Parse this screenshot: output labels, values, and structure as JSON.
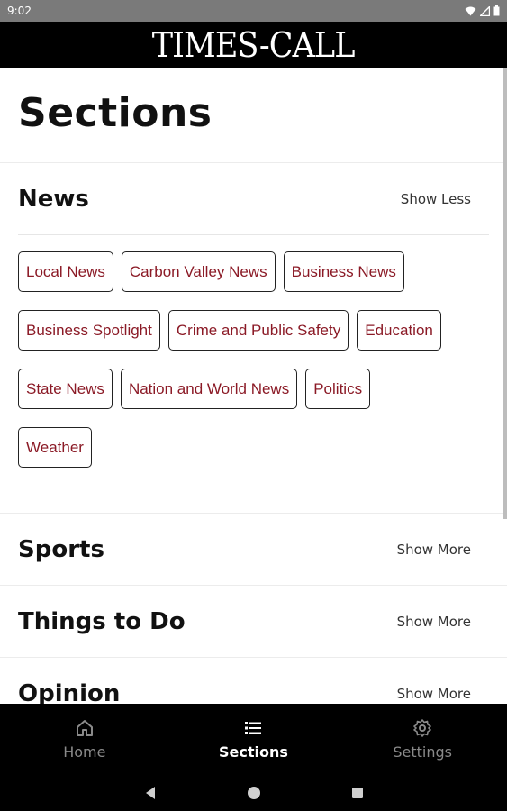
{
  "status_bar": {
    "time": "9:02"
  },
  "masthead": {
    "logo": "TIMES-CALL"
  },
  "page": {
    "title": "Sections"
  },
  "sections": [
    {
      "title": "News",
      "toggle": "Show Less",
      "chips": [
        "Local News",
        "Carbon Valley News",
        "Business News",
        "Business Spotlight",
        "Crime and Public Safety",
        "Education",
        "State News",
        "Nation and World News",
        "Politics",
        "Weather"
      ]
    },
    {
      "title": "Sports",
      "toggle": "Show More"
    },
    {
      "title": "Things to Do",
      "toggle": "Show More"
    },
    {
      "title": "Opinion",
      "toggle": "Show More"
    }
  ],
  "bottom_nav": {
    "items": [
      {
        "label": "Home",
        "icon": "home-icon",
        "active": false
      },
      {
        "label": "Sections",
        "icon": "list-icon",
        "active": true
      },
      {
        "label": "Settings",
        "icon": "gear-icon",
        "active": false
      }
    ]
  },
  "colors": {
    "chip_text": "#8b1a26",
    "masthead_bg": "#000000",
    "status_bg": "#7a7a7a"
  }
}
